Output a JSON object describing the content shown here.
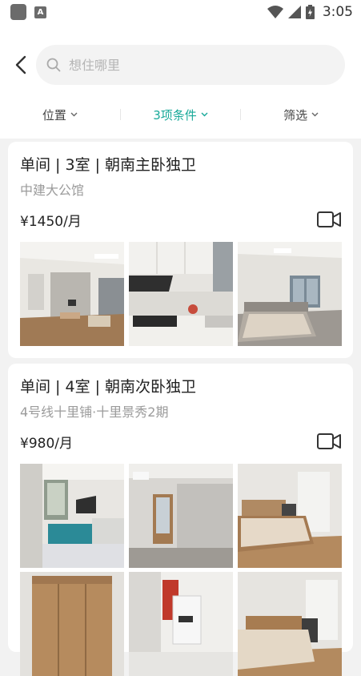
{
  "status_bar": {
    "time": "3:05",
    "app_badge": "A"
  },
  "search": {
    "placeholder": "想住哪里"
  },
  "filters": [
    {
      "label": "位置",
      "active": false
    },
    {
      "label": "3项条件",
      "active": true
    },
    {
      "label": "筛选",
      "active": false
    }
  ],
  "listings": [
    {
      "title": "单间 | 3室 | 朝南主卧独卫",
      "location": "中建大公馆",
      "price": "¥1450/月",
      "photos": [
        "living-room-photo",
        "kitchen-photo",
        "bedroom-photo"
      ]
    },
    {
      "title": "单间 | 4室 | 朝南次卧独卫",
      "location": "4号线十里铺·十里景秀2期",
      "price": "¥980/月",
      "photos": [
        "kitchen-photo",
        "hallway-photo",
        "bedroom-photo",
        "wardrobe-photo",
        "bathroom-photo",
        "bedroom-photo"
      ]
    }
  ],
  "colors": {
    "accent": "#18a999",
    "background": "#f2f2f2",
    "card": "#ffffff"
  }
}
